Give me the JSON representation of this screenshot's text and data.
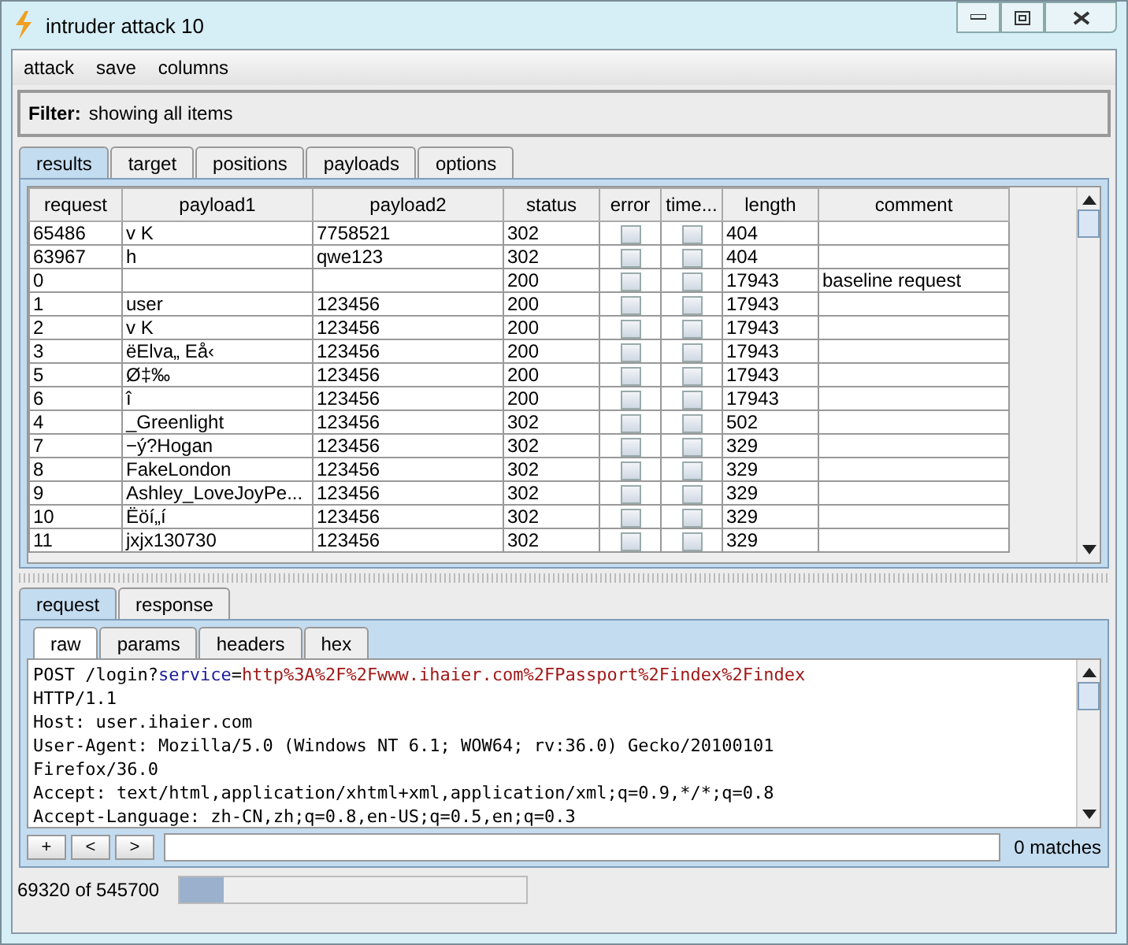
{
  "window": {
    "title": "intruder attack 10"
  },
  "menu": [
    "attack",
    "save",
    "columns"
  ],
  "filter": {
    "label": "Filter:",
    "text": "showing all items"
  },
  "tabs": [
    {
      "label": "results",
      "selected": true
    },
    {
      "label": "target",
      "selected": false
    },
    {
      "label": "positions",
      "selected": false
    },
    {
      "label": "payloads",
      "selected": false
    },
    {
      "label": "options",
      "selected": false
    }
  ],
  "table": {
    "columns": [
      "request",
      "payload1",
      "payload2",
      "status",
      "error",
      "time...",
      "length",
      "comment"
    ],
    "rows": [
      {
        "request": "65486",
        "payload1": "v K",
        "payload2": "7758521",
        "status": "302",
        "error": false,
        "timeout": false,
        "length": "404",
        "comment": ""
      },
      {
        "request": "63967",
        "payload1": "h",
        "payload2": "qwe123",
        "status": "302",
        "error": false,
        "timeout": false,
        "length": "404",
        "comment": ""
      },
      {
        "request": "0",
        "payload1": "",
        "payload2": "",
        "status": "200",
        "error": false,
        "timeout": false,
        "length": "17943",
        "comment": "baseline request"
      },
      {
        "request": "1",
        "payload1": "user",
        "payload2": "123456",
        "status": "200",
        "error": false,
        "timeout": false,
        "length": "17943",
        "comment": ""
      },
      {
        "request": "2",
        "payload1": "v K",
        "payload2": "123456",
        "status": "200",
        "error": false,
        "timeout": false,
        "length": "17943",
        "comment": ""
      },
      {
        "request": "3",
        "payload1": "ëElva„ Eå‹",
        "payload2": "123456",
        "status": "200",
        "error": false,
        "timeout": false,
        "length": "17943",
        "comment": ""
      },
      {
        "request": "5",
        "payload1": "Ø‡‰",
        "payload2": "123456",
        "status": "200",
        "error": false,
        "timeout": false,
        "length": "17943",
        "comment": ""
      },
      {
        "request": "6",
        "payload1": "  î",
        "payload2": "123456",
        "status": "200",
        "error": false,
        "timeout": false,
        "length": "17943",
        "comment": ""
      },
      {
        "request": "4",
        "payload1": "_Greenlight",
        "payload2": "123456",
        "status": "302",
        "error": false,
        "timeout": false,
        "length": "502",
        "comment": ""
      },
      {
        "request": "7",
        "payload1": "−ý?Hogan",
        "payload2": "123456",
        "status": "302",
        "error": false,
        "timeout": false,
        "length": "329",
        "comment": ""
      },
      {
        "request": "8",
        "payload1": "FakeLondon",
        "payload2": "123456",
        "status": "302",
        "error": false,
        "timeout": false,
        "length": "329",
        "comment": ""
      },
      {
        "request": "9",
        "payload1": "Ashley_LoveJoyPe...",
        "payload2": "123456",
        "status": "302",
        "error": false,
        "timeout": false,
        "length": "329",
        "comment": ""
      },
      {
        "request": "10",
        "payload1": "Ëöí„í",
        "payload2": "123456",
        "status": "302",
        "error": false,
        "timeout": false,
        "length": "329",
        "comment": ""
      },
      {
        "request": "11",
        "payload1": "jxjx130730",
        "payload2": "123456",
        "status": "302",
        "error": false,
        "timeout": false,
        "length": "329",
        "comment": ""
      }
    ]
  },
  "message_tabs": [
    {
      "label": "request",
      "selected": true
    },
    {
      "label": "response",
      "selected": false
    }
  ],
  "view_tabs": [
    {
      "label": "raw",
      "selected": true
    },
    {
      "label": "params",
      "selected": false
    },
    {
      "label": "headers",
      "selected": false
    },
    {
      "label": "hex",
      "selected": false
    }
  ],
  "request_lines": [
    [
      {
        "kind": "plain",
        "text": "POST /login?"
      },
      {
        "kind": "param-name",
        "text": "service"
      },
      {
        "kind": "plain",
        "text": "="
      },
      {
        "kind": "param-value",
        "text": "http%3A%2F%2Fwww.ihaier.com%2FPassport%2Findex%2Findex"
      }
    ],
    [
      {
        "kind": "plain",
        "text": "HTTP/1.1"
      }
    ],
    [
      {
        "kind": "plain",
        "text": "Host: user.ihaier.com"
      }
    ],
    [
      {
        "kind": "plain",
        "text": "User-Agent: Mozilla/5.0 (Windows NT 6.1; WOW64; rv:36.0) Gecko/20100101"
      }
    ],
    [
      {
        "kind": "plain",
        "text": "Firefox/36.0"
      }
    ],
    [
      {
        "kind": "plain",
        "text": "Accept: text/html,application/xhtml+xml,application/xml;q=0.9,*/*;q=0.8"
      }
    ],
    [
      {
        "kind": "plain",
        "text": "Accept-Language: zh-CN,zh;q=0.8,en-US;q=0.5,en;q=0.3"
      }
    ]
  ],
  "search": {
    "buttons": [
      "+",
      "<",
      ">"
    ],
    "matches": "0 matches"
  },
  "status_bar": {
    "text": "69320 of 545700",
    "level": 0.127
  }
}
